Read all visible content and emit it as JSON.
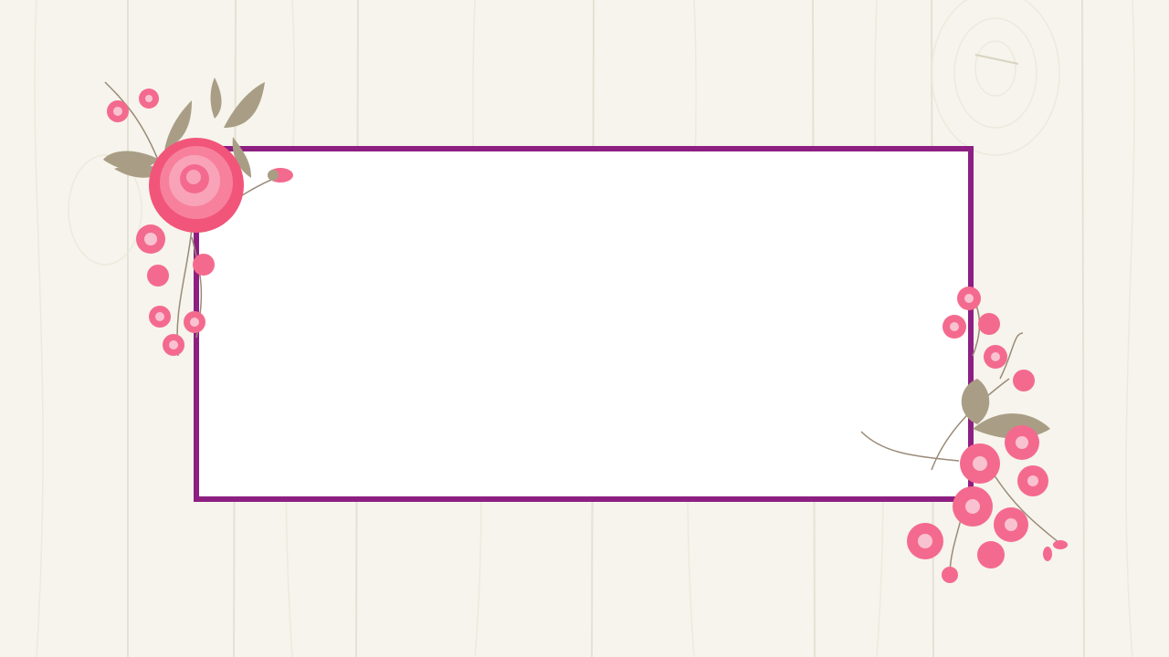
{
  "colors": {
    "background": "#f6f4ec",
    "plank_shadow": "#e4e0d2",
    "frame_border": "#8e1f82",
    "frame_fill": "#ffffff",
    "rose_main": "#f2557a",
    "rose_light": "#f9a3b8",
    "blossom": "#f46a8e",
    "leaf": "#a99e85",
    "stem": "#9a8b78"
  },
  "frame": {
    "content": ""
  },
  "decorations": {
    "top_left": "rose-bouquet-icon",
    "bottom_right": "blossom-branch-icon"
  }
}
